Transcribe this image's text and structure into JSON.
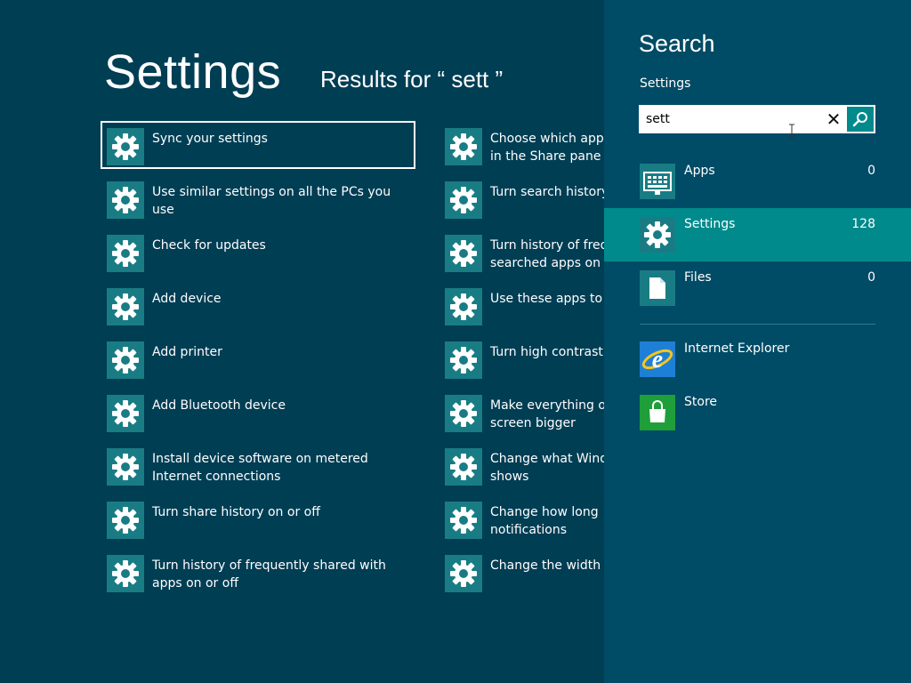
{
  "results": {
    "title": "Settings",
    "subtitle": "Results for “ sett ”",
    "col1": [
      {
        "label": "Sync your settings"
      },
      {
        "label": "Use similar settings on all the PCs you use"
      },
      {
        "label": "Check for updates"
      },
      {
        "label": "Add device"
      },
      {
        "label": "Add printer"
      },
      {
        "label": "Add Bluetooth device"
      },
      {
        "label": "Install device software on metered Internet connections"
      },
      {
        "label": "Turn share history on or off"
      },
      {
        "label": "Turn history of frequently shared with apps on or off"
      }
    ],
    "col2": [
      {
        "label": "Choose which apps appear in the Share pane"
      },
      {
        "label": "Turn search history on or off"
      },
      {
        "label": "Turn history of frequently searched apps on or off"
      },
      {
        "label": "Use these apps to search"
      },
      {
        "label": "Turn high contrast on or off"
      },
      {
        "label": "Make everything on your screen bigger"
      },
      {
        "label": "Change what Windows shows"
      },
      {
        "label": "Change how long notifications"
      },
      {
        "label": "Change the width of"
      }
    ]
  },
  "charm": {
    "title": "Search",
    "scope": "Settings",
    "query": "sett",
    "categories": [
      {
        "name": "Apps",
        "count": "0",
        "icon": "apps-icon"
      },
      {
        "name": "Settings",
        "count": "128",
        "icon": "gear-icon"
      },
      {
        "name": "Files",
        "count": "0",
        "icon": "file-icon"
      }
    ],
    "apps": [
      {
        "name": "Internet Explorer",
        "icon": "internet-explorer-icon"
      },
      {
        "name": "Store",
        "icon": "store-icon"
      }
    ]
  },
  "colors": {
    "background": "#003e54",
    "charm_background": "#004b65",
    "accent": "#008a8c",
    "tile": "#197c85"
  }
}
